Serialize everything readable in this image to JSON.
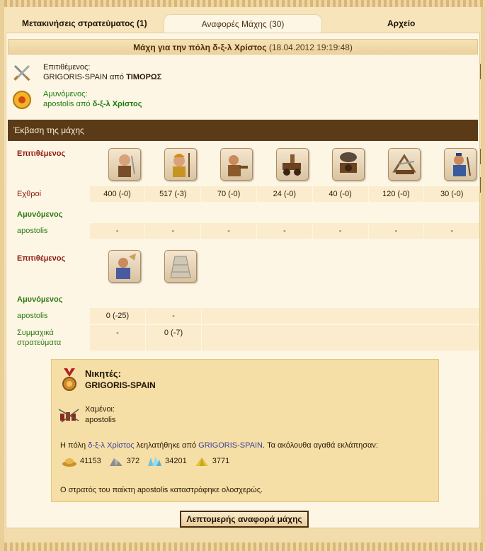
{
  "tabs": [
    {
      "label": "Μετακινήσεις στρατεύματος (1)"
    },
    {
      "label": "Αναφορές Μάχης (30)"
    },
    {
      "label": "Αρχείο"
    }
  ],
  "battle": {
    "title_prefix": "Μάχη για την πόλη",
    "city": "δ-ξ-λ Χρίστος",
    "date": "(18.04.2012 19:19:48)"
  },
  "attacker": {
    "label": "Επιτιθέμενος:",
    "player": "GRIGORIS-SPAIN",
    "from_word": "από",
    "city": "ΤΙΜΟΡΩΣ"
  },
  "defender": {
    "label": "Αμυνόμενος:",
    "player": "apostolis",
    "from_word": "από",
    "city": "δ-ξ-λ Χρίστος"
  },
  "outcome_header": "Έκβαση της μάχης",
  "land": {
    "attacker_label": "Επιτιθέμενος",
    "enemies_label": "Εχθροί",
    "enemies_values": [
      "400 (-0)",
      "517 (-3)",
      "70 (-0)",
      "24 (-0)",
      "40 (-0)",
      "120 (-0)",
      "30 (-0)"
    ],
    "units": [
      "swordsman-icon",
      "hoplite-icon",
      "slinger-icon",
      "chariot-icon",
      "catapult-icon",
      "ballista-icon",
      "archer-icon"
    ],
    "defender_label": "Αμυνόμενος",
    "defender_player": "apostolis",
    "defender_values": [
      "-",
      "-",
      "-",
      "-",
      "-",
      "-",
      "-"
    ]
  },
  "militia": {
    "attacker_label": "Επιτιθέμενος",
    "units": [
      "militia-icon",
      "wall-icon"
    ],
    "defender_label": "Αμυνόμενος",
    "defender_player": "apostolis",
    "defender_values": [
      "0 (-25)",
      "-"
    ],
    "allies_label": "Συμμαχικά στρατεύματα",
    "allies_values": [
      "-",
      "0 (-7)"
    ]
  },
  "result": {
    "winners_label": "Νικητές:",
    "winner": "GRIGORIS-SPAIN",
    "losers_label": "Χαμένοι:",
    "loser": "apostolis",
    "loot_prefix": "Η πόλη",
    "loot_city": "δ-ξ-λ Χρίστος",
    "loot_mid": "λεηλατήθηκε από",
    "loot_player": "GRIGORIS-SPAIN",
    "loot_suffix": ". Τα ακόλουθα αγαθά εκλάπησαν:",
    "resources": [
      {
        "icon": "gold-icon",
        "value": "41153"
      },
      {
        "icon": "stone-icon",
        "value": "372"
      },
      {
        "icon": "crystal-icon",
        "value": "34201"
      },
      {
        "icon": "sulfur-icon",
        "value": "3771"
      }
    ],
    "destroyed": "Ο στρατός του παίκτη apostolis καταστράφηκε ολοσχερώς."
  },
  "detail_button": "Λεπτομερής αναφορά μάχης",
  "colors": {
    "header_bar": "#5a3a17",
    "attacker_red": "#8f1a12",
    "defender_green": "#2f7a12",
    "link_blue": "#3c3f98",
    "winner_box": "#f5dfa6"
  }
}
